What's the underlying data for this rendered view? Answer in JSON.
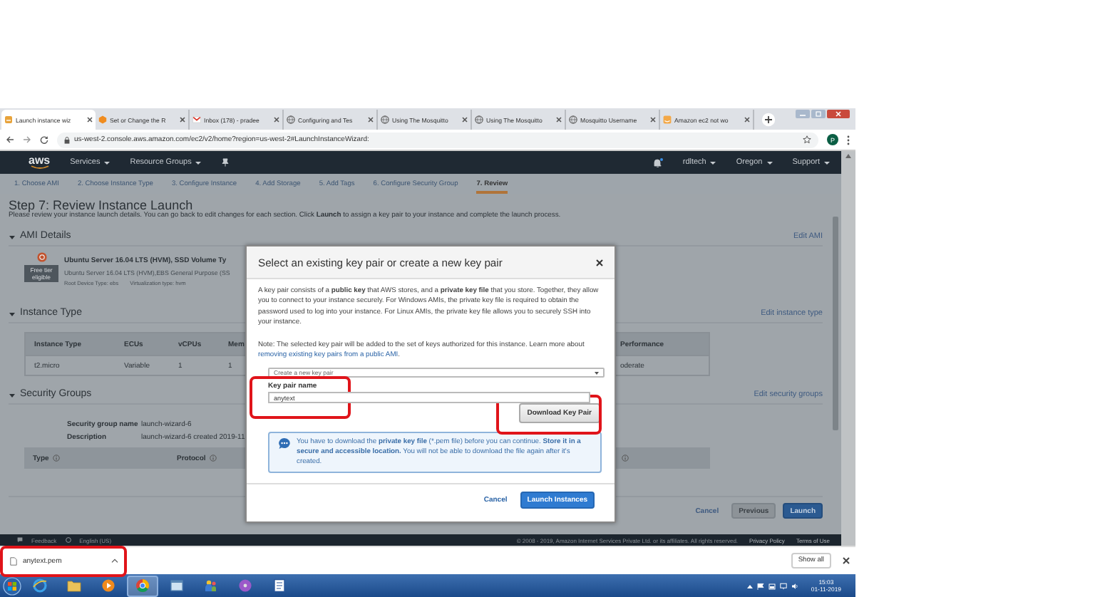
{
  "browser": {
    "tabs": [
      {
        "title": "Launch instance wiz",
        "kind": "aws",
        "selected": true
      },
      {
        "title": "Set or Change the R",
        "kind": "hex",
        "selected": false
      },
      {
        "title": "Inbox (178) - pradee",
        "kind": "mail",
        "selected": false
      },
      {
        "title": "Configuring and Tes",
        "kind": "globe",
        "selected": false
      },
      {
        "title": "Using The Mosquitto",
        "kind": "globe",
        "selected": false
      },
      {
        "title": "Using The Mosquitto",
        "kind": "globe",
        "selected": false
      },
      {
        "title": "Mosquitto Username",
        "kind": "globe",
        "selected": false
      },
      {
        "title": "Amazon ec2 not wo",
        "kind": "amazon",
        "selected": false
      }
    ],
    "address": "us-west-2.console.aws.amazon.com/ec2/v2/home?region=us-west-2#LaunchInstanceWizard:",
    "profile_initial": "P"
  },
  "console_nav": {
    "logo": "aws",
    "menus": [
      "Services",
      "Resource Groups"
    ],
    "notifications_unread": true,
    "right_menus": [
      "rdltech",
      "Oregon",
      "Support"
    ]
  },
  "wizard_steps": [
    {
      "label": "1. Choose AMI",
      "selected": false
    },
    {
      "label": "2. Choose Instance Type",
      "selected": false
    },
    {
      "label": "3. Configure Instance",
      "selected": false
    },
    {
      "label": "4. Add Storage",
      "selected": false
    },
    {
      "label": "5. Add Tags",
      "selected": false
    },
    {
      "label": "6. Configure Security Group",
      "selected": false
    },
    {
      "label": "7. Review",
      "selected": true
    }
  ],
  "page": {
    "title": "Step 7: Review Instance Launch",
    "description": "Please review your instance launch details. You can go back to edit changes for each section. Click **Launch** to assign a key pair to your instance and complete the launch process.",
    "sections": [
      {
        "kind": "ami",
        "title": "AMI Details",
        "edit_link": "Edit AMI",
        "expanded": true,
        "ami_name": "Ubuntu Server 16.04 LTS (HVM), SSD Volume Ty",
        "badge": "Free tier eligible",
        "ami_description": "Ubuntu Server 16.04 LTS (HVM),EBS General Purpose (SS",
        "root_device": "Root Device Type: ebs",
        "virtualization": "Virtualization type: hvm"
      },
      {
        "kind": "instance",
        "title": "Instance Type",
        "edit_link": "Edit instance type",
        "expanded": true,
        "columns": [
          "Instance Type",
          "ECUs",
          "vCPUs",
          "Mem"
        ],
        "row": [
          "t2.micro",
          "Variable",
          "1",
          "1"
        ],
        "right_column": "Performance",
        "right_value": "oderate"
      },
      {
        "kind": "security",
        "title": "Security Groups",
        "edit_link": "Edit security groups",
        "expanded": true,
        "fields": [
          {
            "label": "Security group name",
            "value": "launch-wizard-6"
          },
          {
            "label": "Description",
            "value": "launch-wizard-6 created 2019-11"
          }
        ],
        "columns": [
          "Type",
          "Protocol"
        ]
      }
    ],
    "buttons": [
      {
        "label": "Cancel",
        "kind": "link"
      },
      {
        "label": "Previous",
        "kind": "secondary"
      },
      {
        "label": "Launch",
        "kind": "primary"
      }
    ]
  },
  "footer": {
    "links": [
      "Feedback",
      "English (US)"
    ],
    "copyright": "© 2008 - 2019, Amazon Internet Services Private Ltd. or its affiliates. All rights reserved.",
    "right_links": [
      "Privacy Policy",
      "Terms of Use"
    ]
  },
  "modal": {
    "title": "Select an existing key pair or create a new key pair",
    "intro": "A key pair consists of a **public key** that AWS stores, and a **private key file** that you store. Together, they allow you to connect to your instance securely. For Windows AMIs, the private key file is required to obtain the password used to log into your instance. For Linux AMIs, the private key file allows you to securely SSH into your instance.",
    "note": "Note: The selected key pair will be added to the set of keys authorized for this instance. Learn more about ",
    "note_link": "removing existing key pairs from a public AMI",
    "note_end": ".",
    "key_pair_option": "Create a new key pair",
    "name_label": "Key pair name",
    "name_value": "anytext",
    "name_highlighted": true,
    "download_button": "Download Key Pair",
    "download_highlighted": true,
    "notice": "You have to download the **private key file** (*.pem file) before you can continue. **Store it in a secure and accessible location.** You will not be able to download the file again after it's created.",
    "buttons": [
      {
        "label": "Cancel",
        "kind": "link"
      },
      {
        "label": "Launch Instances",
        "kind": "primary"
      }
    ]
  },
  "downloads": {
    "file": "anytext.pem",
    "highlighted": true,
    "show_all": "Show all"
  },
  "taskbar": {
    "apps": [
      {
        "kind": "ie",
        "selected": false
      },
      {
        "kind": "folder",
        "selected": false
      },
      {
        "kind": "media",
        "selected": false
      },
      {
        "kind": "chrome",
        "selected": true
      },
      {
        "kind": "window",
        "selected": false
      },
      {
        "kind": "people",
        "selected": false
      },
      {
        "kind": "disc",
        "selected": false
      },
      {
        "kind": "doc",
        "selected": false
      }
    ],
    "time": "15:03",
    "date": "01-11-2019"
  }
}
